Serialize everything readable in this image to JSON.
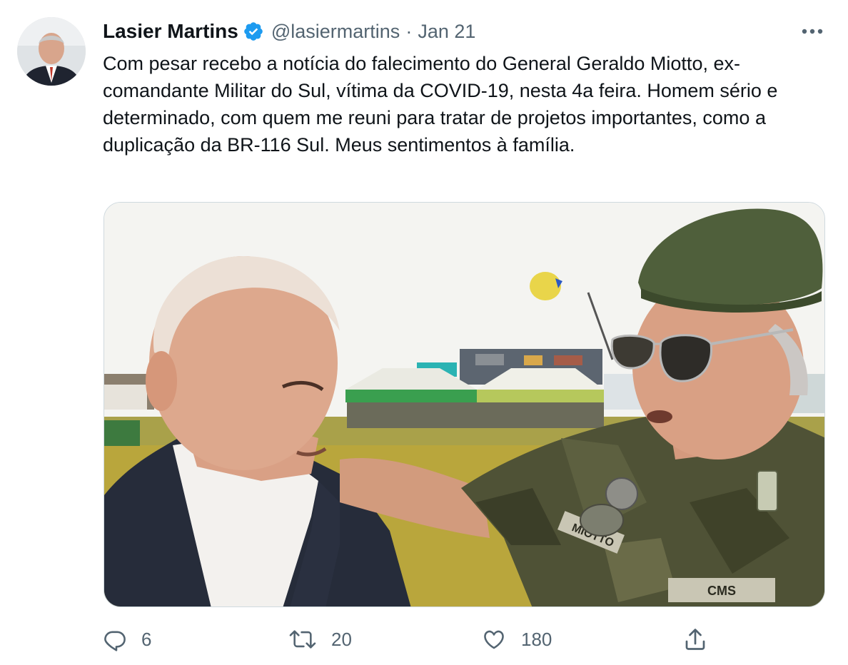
{
  "tweet": {
    "author_name": "Lasier Martins",
    "handle": "@lasiermartins",
    "separator": "·",
    "date": "Jan 21",
    "verified": true,
    "text": "Com pesar recebo a notícia do falecimento do General Geraldo Miotto, ex-comandante Militar do Sul, vítima da COVID-19, nesta 4a feira. Homem sério e determinado, com quem me reuni para tratar de projetos importantes, como a duplicação da BR-116 Sul. Meus sentimentos à família.",
    "media": {
      "patch_miotto": "MIOTTO",
      "patch_cms": "CMS"
    }
  },
  "actions": {
    "replies": "6",
    "retweets": "20",
    "likes": "180",
    "reply_icon": "reply-icon",
    "retweet_icon": "retweet-icon",
    "like_icon": "heart-icon",
    "share_icon": "share-icon"
  },
  "colors": {
    "verified": "#1d9bf0",
    "secondary_text": "#536471",
    "primary_text": "#0f1419"
  }
}
